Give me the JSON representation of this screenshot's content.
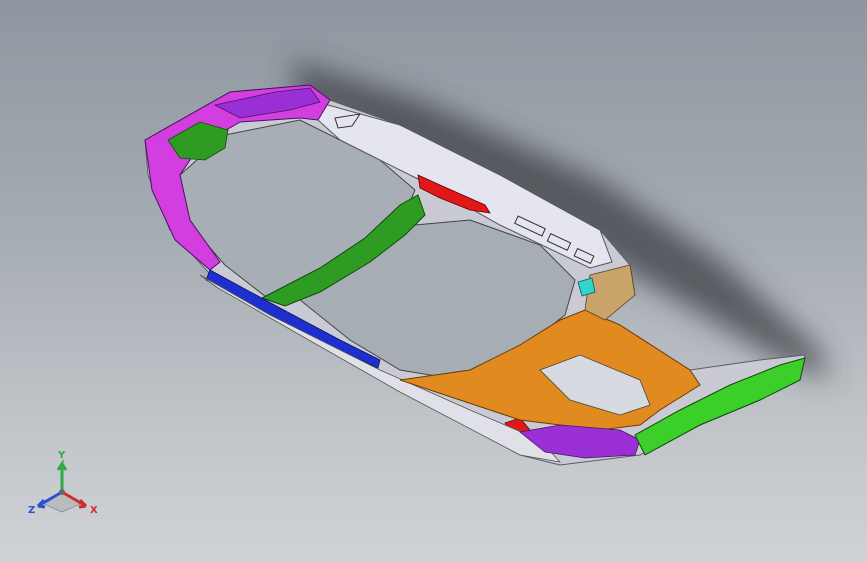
{
  "viewport": {
    "background_top": "#8e969f",
    "background_bottom": "#cfd2d5"
  },
  "model": {
    "colors": {
      "purple": "#9b2fd6",
      "magenta": "#d23ee0",
      "green": "#2e9b23",
      "bright_green": "#3ccf2a",
      "orange": "#e08a1f",
      "red": "#e01818",
      "blue": "#1e2fd0",
      "cyan": "#2fd6c9",
      "tan": "#c8a46a",
      "silver": "#dcdde6"
    }
  },
  "triad": {
    "y_label": "Y",
    "x_label": "X",
    "z_label": "Z",
    "y_color": "#2fa84a",
    "x_color": "#d42c2c",
    "z_color": "#2c4fd4"
  }
}
